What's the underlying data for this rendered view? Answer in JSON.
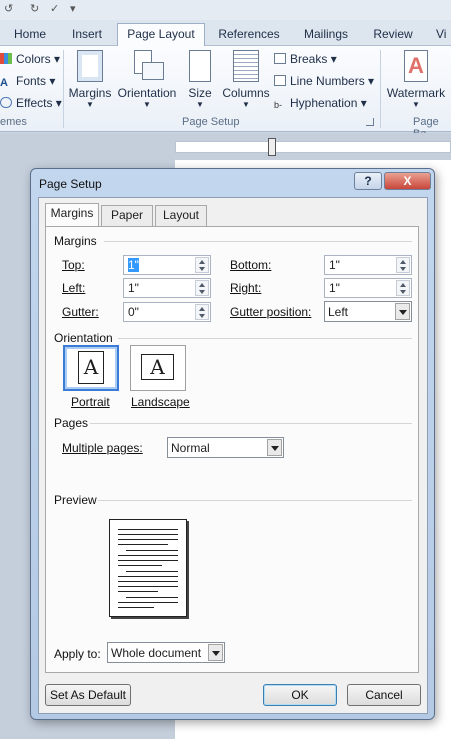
{
  "ribbon_tabs": [
    "Home",
    "Insert",
    "Page Layout",
    "References",
    "Mailings",
    "Review",
    "Vi"
  ],
  "active_tab": "Page Layout",
  "theme_group": {
    "colors": "Colors",
    "fonts": "Fonts",
    "effects": "Effects",
    "label_fragment": "emes"
  },
  "page_setup_group": {
    "margins": "Margins",
    "orientation": "Orientation",
    "size": "Size",
    "columns": "Columns",
    "breaks": "Breaks",
    "line_numbers": "Line Numbers",
    "hyphenation": "Hyphenation",
    "label": "Page Setup"
  },
  "background_group": {
    "watermark": "Watermark",
    "label_fragment": "Page Ba"
  },
  "dialog": {
    "title": "Page Setup",
    "help_button": "?",
    "close_button": "X",
    "tabs": [
      "Margins",
      "Paper",
      "Layout"
    ],
    "active_tab": "Margins",
    "margins_section": "Margins",
    "top_label": "Top:",
    "top_value": "1\"",
    "bottom_label": "Bottom:",
    "bottom_value": "1\"",
    "left_label": "Left:",
    "left_value": "1\"",
    "right_label": "Right:",
    "right_value": "1\"",
    "gutter_label": "Gutter:",
    "gutter_value": "0\"",
    "gutter_position_label": "Gutter position:",
    "gutter_position_value": "Left",
    "orientation_section": "Orientation",
    "portrait_label": "Portrait",
    "landscape_label": "Landscape",
    "orientation_glyph": "A",
    "selected_orientation": "Portrait",
    "pages_section": "Pages",
    "multiple_pages_label": "Multiple pages:",
    "multiple_pages_value": "Normal",
    "preview_section": "Preview",
    "apply_to_label": "Apply to:",
    "apply_to_value": "Whole document",
    "set_default_button": "Set As Default",
    "ok_button": "OK",
    "cancel_button": "Cancel"
  },
  "colors": {
    "accent": "#3b7bd6",
    "dialog_frame": "#b4c9e4",
    "close_red": "#c8463a"
  }
}
